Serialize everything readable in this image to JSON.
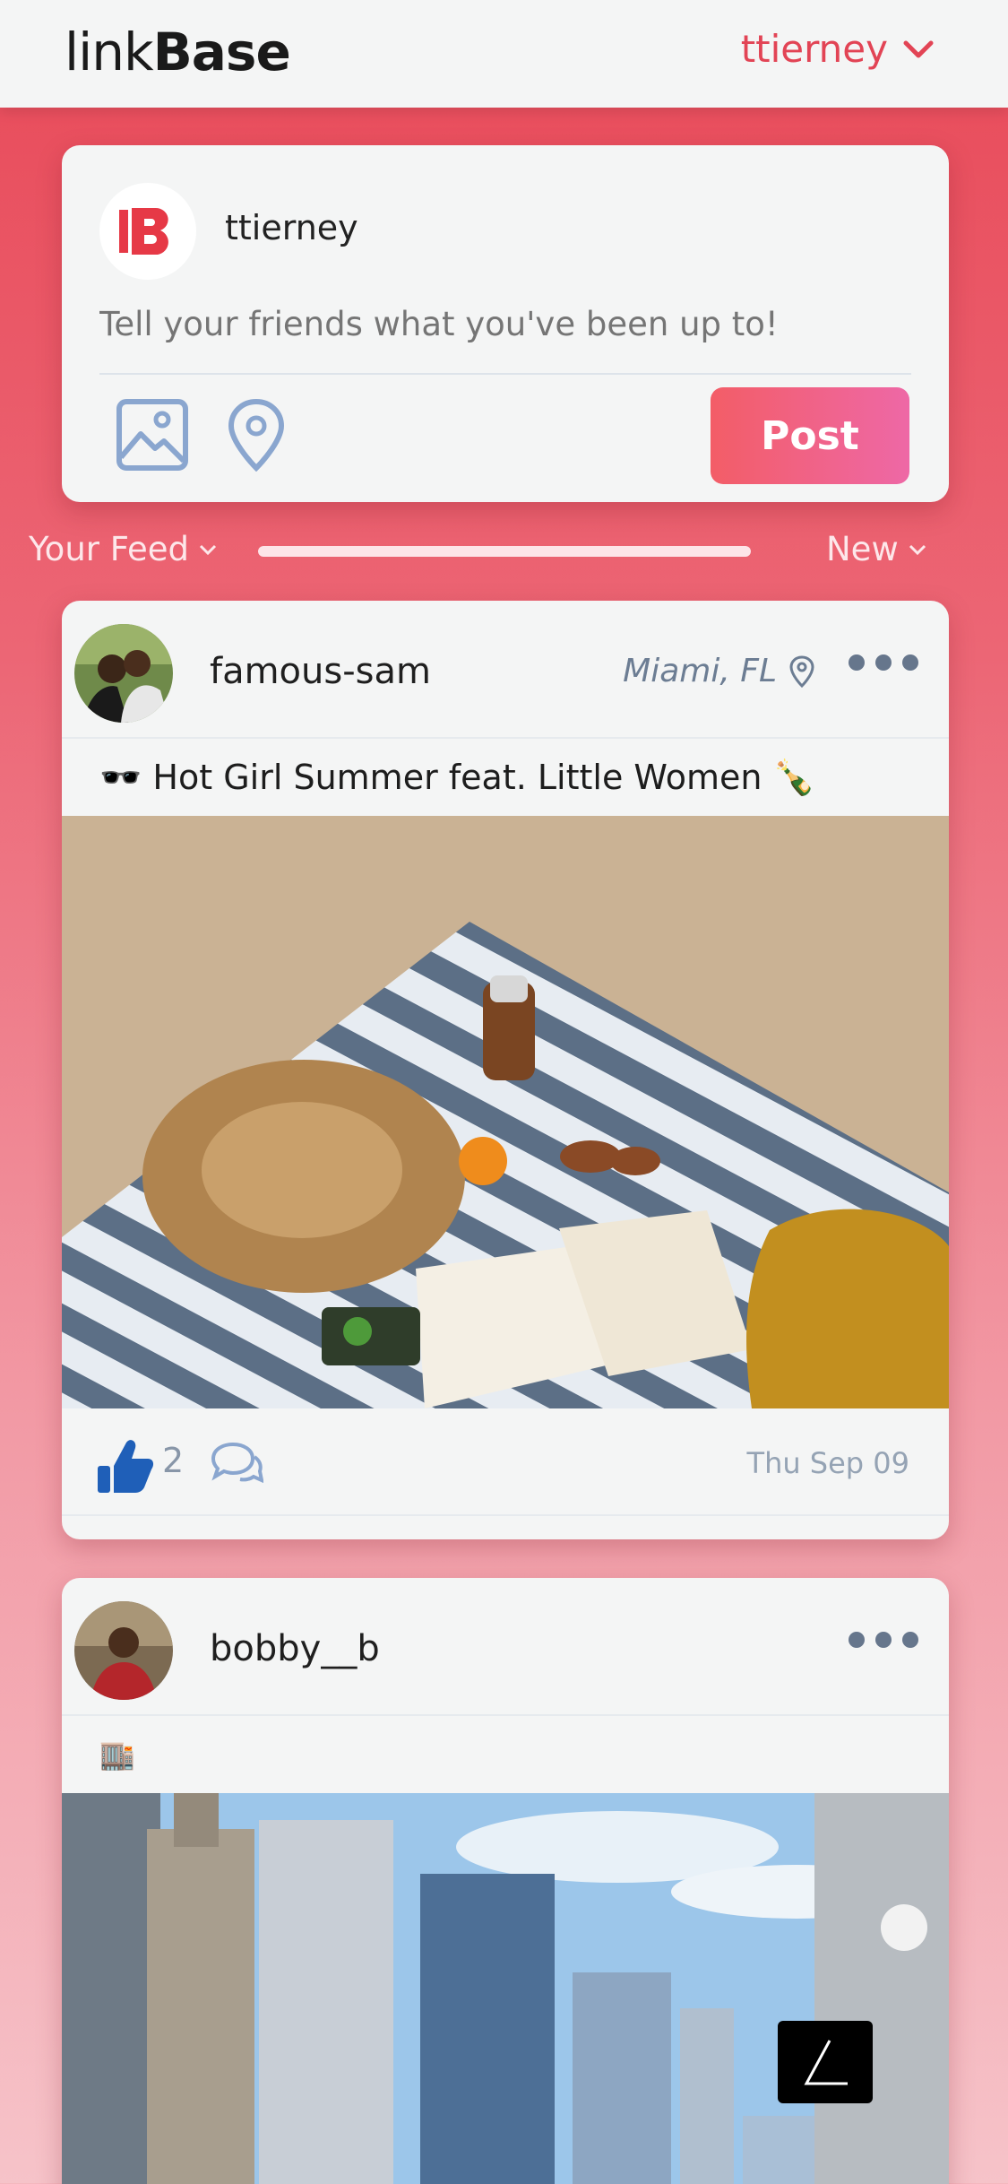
{
  "header": {
    "logo_light": "link",
    "logo_bold": "Base",
    "username": "ttierney"
  },
  "composer": {
    "username": "ttierney",
    "placeholder": "Tell your friends what you've been up to!",
    "post_label": "Post",
    "image_icon": "image-icon",
    "location_icon": "location-pin-icon"
  },
  "feed": {
    "filter_label": "Your Feed",
    "sort_label": "New",
    "progress": 1.0
  },
  "posts": [
    {
      "username": "famous-sam",
      "location": "Miami, FL",
      "caption": "🕶️ Hot Girl Summer feat. Little Women 🍾",
      "likes": "2",
      "date": "Thu Sep 09"
    },
    {
      "username": "bobby__b",
      "location": "",
      "caption": "🏬"
    }
  ],
  "colors": {
    "accent": "#e24455",
    "post_gradient_start": "#f35d67",
    "post_gradient_end": "#ee68a6",
    "like_blue": "#1f5fb8"
  }
}
